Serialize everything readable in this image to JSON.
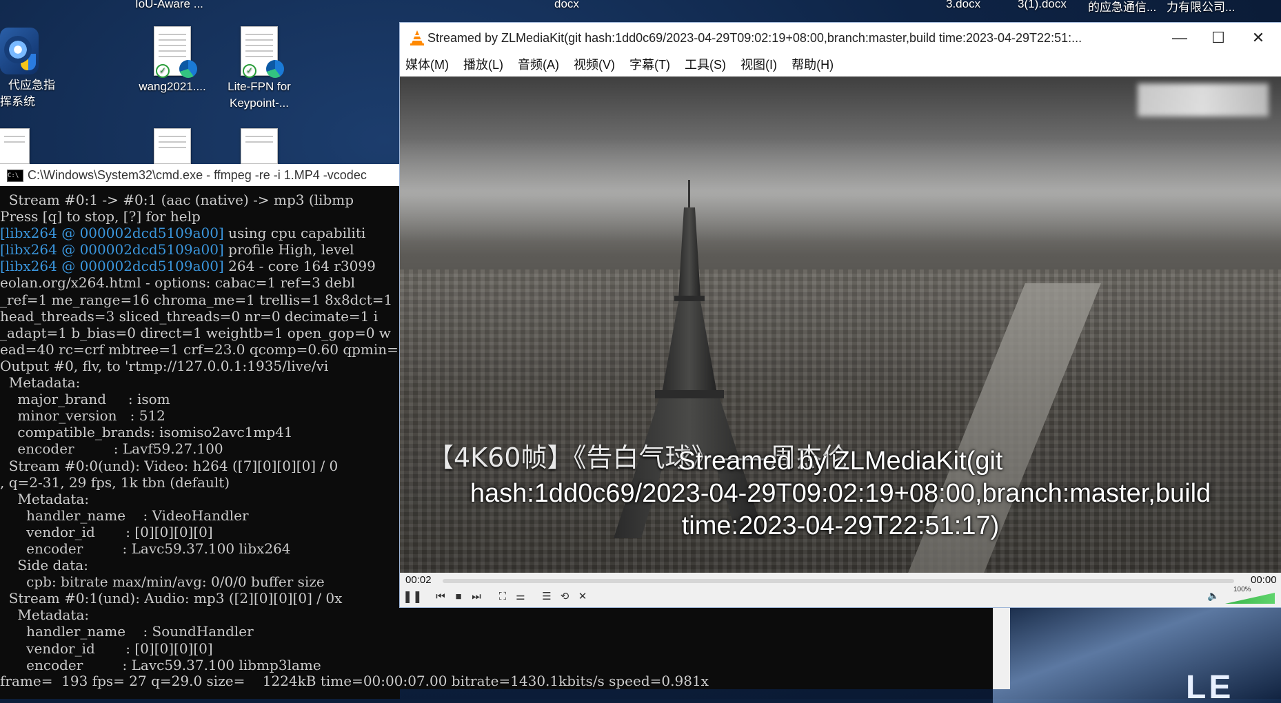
{
  "desktop": {
    "top_labels": [
      "IoU-Aware ...",
      "docx",
      "3.docx",
      "3(1).docx",
      "的应急通信...",
      "力有限公司..."
    ],
    "icons": [
      {
        "label_lines": [
          "代应急指",
          "挥系统"
        ]
      },
      {
        "label_lines": [
          "wang2021...."
        ]
      },
      {
        "label_lines": [
          "Lite-FPN for",
          "Keypoint-..."
        ]
      }
    ]
  },
  "cmd": {
    "title": "C:\\Windows\\System32\\cmd.exe - ffmpeg  -re -i 1.MP4 -vcodec",
    "icon": "cmd-icon",
    "lines": [
      {
        "text": "  Stream #0:1 -> #0:1 (aac (native) -> mp3 (libmp",
        "cyan": false
      },
      {
        "text": "Press [q] to stop, [?] for help",
        "cyan": false
      },
      {
        "prefix": "[libx264 @ 000002dcd5109a00]",
        "text": " using cpu capabiliti",
        "cyan": true
      },
      {
        "prefix": "[libx264 @ 000002dcd5109a00]",
        "text": " profile High, level",
        "cyan": true
      },
      {
        "prefix": "[libx264 @ 000002dcd5109a00]",
        "text": " 264 - core 164 r3099",
        "cyan": true
      },
      {
        "text": "eolan.org/x264.html - options: cabac=1 ref=3 debl",
        "cyan": false
      },
      {
        "text": "_ref=1 me_range=16 chroma_me=1 trellis=1 8x8dct=1",
        "cyan": false
      },
      {
        "text": "head_threads=3 sliced_threads=0 nr=0 decimate=1 i",
        "cyan": false
      },
      {
        "text": "_adapt=1 b_bias=0 direct=1 weightb=1 open_gop=0 w",
        "cyan": false
      },
      {
        "text": "ead=40 rc=crf mbtree=1 crf=23.0 qcomp=0.60 qpmin=",
        "cyan": false
      },
      {
        "text": "Output #0, flv, to 'rtmp://127.0.0.1:1935/live/vi",
        "cyan": false
      },
      {
        "text": "  Metadata:",
        "cyan": false
      },
      {
        "text": "    major_brand     : isom",
        "cyan": false
      },
      {
        "text": "    minor_version   : 512",
        "cyan": false
      },
      {
        "text": "    compatible_brands: isomiso2avc1mp41",
        "cyan": false
      },
      {
        "text": "    encoder         : Lavf59.27.100",
        "cyan": false
      },
      {
        "text": "  Stream #0:0(und): Video: h264 ([7][0][0][0] / 0",
        "cyan": false
      },
      {
        "text": ", q=2-31, 29 fps, 1k tbn (default)",
        "cyan": false
      },
      {
        "text": "    Metadata:",
        "cyan": false
      },
      {
        "text": "      handler_name    : VideoHandler",
        "cyan": false
      },
      {
        "text": "      vendor_id       : [0][0][0][0]",
        "cyan": false
      },
      {
        "text": "      encoder         : Lavc59.37.100 libx264",
        "cyan": false
      },
      {
        "text": "    Side data:",
        "cyan": false
      },
      {
        "text": "      cpb: bitrate max/min/avg: 0/0/0 buffer size",
        "cyan": false
      },
      {
        "text": "  Stream #0:1(und): Audio: mp3 ([2][0][0][0] / 0x",
        "cyan": false
      },
      {
        "text": "    Metadata:",
        "cyan": false
      },
      {
        "text": "      handler_name    : SoundHandler",
        "cyan": false
      },
      {
        "text": "      vendor_id       : [0][0][0][0]",
        "cyan": false
      },
      {
        "text": "      encoder         : Lavc59.37.100 libmp3lame",
        "cyan": false
      }
    ],
    "progress_line": "frame=  193 fps= 27 q=29.0 size=    1224kB time=00:00:07.00 bitrate=1430.1kbits/s speed=0.981x"
  },
  "vlc": {
    "title": "Streamed by ZLMediaKit(git hash:1dd0c69/2023-04-29T09:02:19+08:00,branch:master,build time:2023-04-29T22:51:...",
    "window_buttons": {
      "minimize": "—",
      "maximize": "☐",
      "close": "✕"
    },
    "menu": [
      "媒体(M)",
      "播放(L)",
      "音频(A)",
      "视频(V)",
      "字幕(T)",
      "工具(S)",
      "视图(I)",
      "帮助(H)"
    ],
    "video_caption": "【4K60帧】《告白气球》——周杰伦",
    "video_overlay_lines": [
      "Streamed by ZLMediaKit(git",
      "hash:1dd0c69/2023-04-29T09:02:19+08:00,branch:master,build",
      "time:2023-04-29T22:51:17)"
    ],
    "time_elapsed": "00:02",
    "time_total": "00:00",
    "seek_fraction": 0.0,
    "volume_label": "100%",
    "volume_level": 1.0,
    "controls": {
      "pause": "❚❚",
      "prev": "⏮",
      "stop": "■",
      "next": "⏭",
      "fullscreen": "⛶",
      "extended": "⚌",
      "playlist": "☰",
      "loop": "⟲",
      "shuffle": "✕"
    },
    "accent": "#ff8800"
  }
}
